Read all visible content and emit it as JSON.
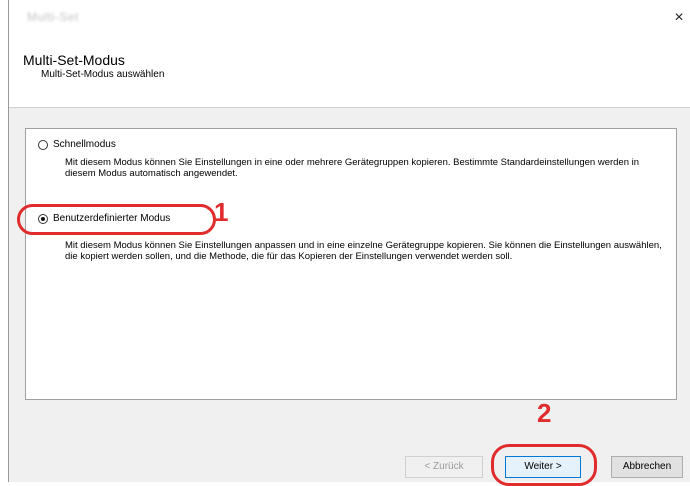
{
  "window": {
    "title": "Multi-Set",
    "close_glyph": "×"
  },
  "header": {
    "title": "Multi-Set-Modus",
    "subtitle": "Multi-Set-Modus auswählen"
  },
  "options": [
    {
      "label": "Schnellmodus",
      "selected": false,
      "description": "Mit diesem Modus können Sie Einstellungen in eine oder mehrere Gerätegruppen kopieren. Bestimmte Standardeinstellungen werden in diesem Modus automatisch angewendet."
    },
    {
      "label": "Benutzerdefinierter Modus",
      "selected": true,
      "description": "Mit diesem Modus können Sie Einstellungen anpassen und in eine einzelne Gerätegruppe kopieren. Sie können die Einstellungen auswählen, die kopiert werden sollen, und die Methode, die für das Kopieren der Einstellungen verwendet werden soll."
    }
  ],
  "callouts": {
    "step1": "1",
    "step2": "2",
    "color": "#e02c2c"
  },
  "footer": {
    "back_label": "< Zurück",
    "next_label": "Weiter >",
    "cancel_label": "Abbrechen"
  }
}
